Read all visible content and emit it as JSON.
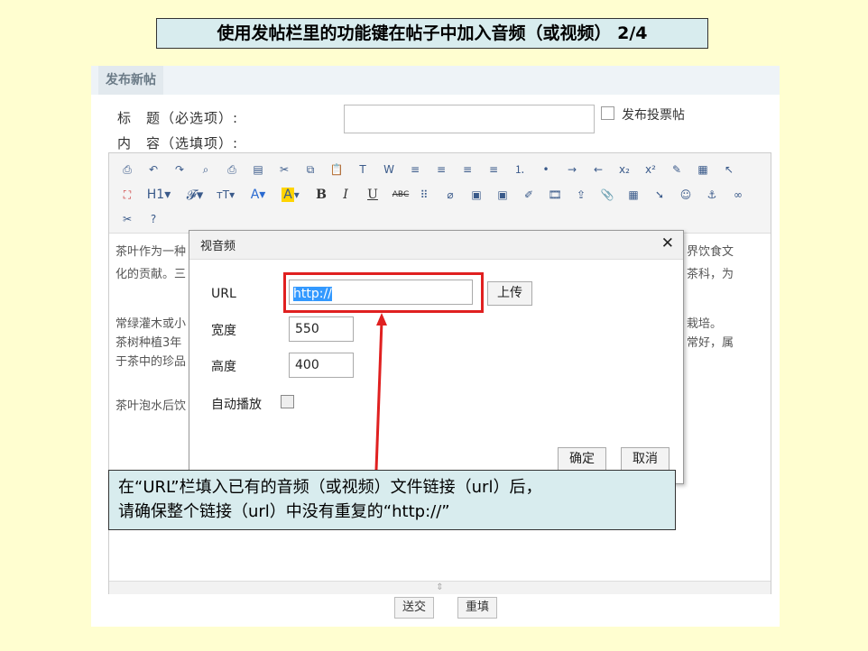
{
  "slide_title": "使用发帖栏里的功能键在帖子中加入音频（或视频） 2/4",
  "panel": {
    "tab": "发布新帖",
    "subject_label": "标　题（必选项）:",
    "content_label": "内　容（选填项）:",
    "poll_label": "发布投票帖",
    "submit_button": "送交",
    "reset_button": "重填",
    "grip": "⇕"
  },
  "toolbar": {
    "icons_row1": [
      "source-icon",
      "undo-icon",
      "redo-icon",
      "preview-icon",
      "print-icon",
      "template-icon",
      "cut-icon",
      "copy-icon",
      "paste-icon",
      "paste-text-icon",
      "paste-word-icon",
      "align-left-icon",
      "align-center-icon",
      "align-right-icon",
      "align-justify-icon",
      "ordered-list-icon",
      "unordered-list-icon",
      "indent-icon",
      "outdent-icon",
      "subscript-icon",
      "superscript-icon",
      "clear-format-icon",
      "select-all-icon",
      "pointer-icon"
    ],
    "row1_glyphs": [
      "⎙",
      "↶",
      "↷",
      "⌕",
      "⎙",
      "▤",
      "✂",
      "⧉",
      "📋",
      "T",
      "W",
      "≡",
      "≡",
      "≡",
      "≡",
      "⒈",
      "•",
      "→",
      "←",
      "x₂",
      "x²",
      "✎",
      "▦",
      "↖"
    ],
    "h1": "H1",
    "font_family": "𝓕",
    "font_size": "тT",
    "font_color": "A",
    "highlight": "A",
    "bold": "B",
    "italic": "I",
    "underline": "U",
    "strike": "ABC",
    "row2_glyphs": [
      "⠿",
      "⌀",
      "▣",
      "▣",
      "✐",
      "🎞",
      "⇪",
      "📎",
      "▦",
      "➘",
      "☺",
      "⚓",
      "∞"
    ],
    "row3_glyphs": [
      "✂",
      "?"
    ]
  },
  "editor_content": {
    "line1_left": "茶叶作为一种",
    "line1_right": "界饮食文",
    "line2_left": "化的贡献。三",
    "line2_right": "茶科，为",
    "line3_left": "常绿灌木或小",
    "line3_right": "栽培。",
    "line4_left": "茶树种植3年",
    "line4_right": "常好，属",
    "line5_left": "于茶中的珍品",
    "line6_left": "茶叶泡水后饮"
  },
  "dialog": {
    "title": "视音频",
    "close": "✕",
    "url_label": "URL",
    "url_value": "http://",
    "upload_button": "上传",
    "width_label": "宽度",
    "width_value": "550",
    "height_label": "高度",
    "height_value": "400",
    "autoplay_label": "自动播放",
    "ok_button": "确定",
    "cancel_button": "取消"
  },
  "callout": {
    "line1": "在“URL”栏填入已有的音频（或视频）文件链接（url）后，",
    "line2": "请确保整个链接（url）中没有重复的“http://”"
  },
  "colors": {
    "background": "#fffed0",
    "title_box": "#d8ecee",
    "highlight_box": "#e02020",
    "selection": "#3399ff"
  }
}
